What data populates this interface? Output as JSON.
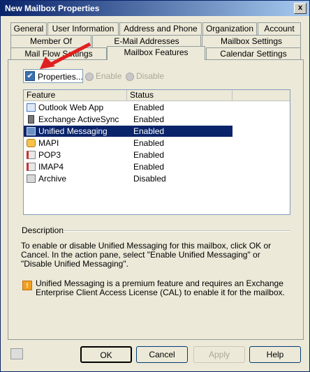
{
  "window": {
    "title": "New Mailbox Properties",
    "close_glyph": "x"
  },
  "tabs_row1": [
    "General",
    "User Information",
    "Address and Phone",
    "Organization",
    "Account"
  ],
  "tabs_row2": [
    "Member Of",
    "E-Mail Addresses",
    "Mailbox Settings"
  ],
  "tabs_row3": [
    "Mail Flow Settings",
    "Mailbox Features",
    "Calendar Settings"
  ],
  "active_tab": "Mailbox Features",
  "toolbar": {
    "properties": "Properties...",
    "enable": "Enable",
    "disable": "Disable"
  },
  "list": {
    "columns": [
      "Feature",
      "Status"
    ],
    "rows": [
      {
        "feature": "Outlook Web App",
        "status": "Enabled",
        "icon": "outlook-web-app-icon"
      },
      {
        "feature": "Exchange ActiveSync",
        "status": "Enabled",
        "icon": "activesync-icon"
      },
      {
        "feature": "Unified Messaging",
        "status": "Enabled",
        "icon": "unified-messaging-icon",
        "selected": true
      },
      {
        "feature": "MAPI",
        "status": "Enabled",
        "icon": "mapi-icon"
      },
      {
        "feature": "POP3",
        "status": "Enabled",
        "icon": "pop3-icon"
      },
      {
        "feature": "IMAP4",
        "status": "Enabled",
        "icon": "imap4-icon"
      },
      {
        "feature": "Archive",
        "status": "Disabled",
        "icon": "archive-icon"
      }
    ]
  },
  "description": {
    "label": "Description",
    "text": "To enable or disable Unified Messaging for this mailbox, click OK or Cancel. In the action pane, select \"Enable Unified Messaging\" or \"Disable Unified Messaging\".",
    "warning": "Unified Messaging is a premium feature and requires an Exchange Enterprise Client Access License (CAL) to enable it for the mailbox."
  },
  "buttons": {
    "ok": "OK",
    "cancel": "Cancel",
    "apply": "Apply",
    "help": "Help"
  },
  "colors": {
    "title_bar": "#0a246a",
    "selection": "#0a246a",
    "arrow": "#e02020",
    "warning_icon": "#f0a020"
  }
}
